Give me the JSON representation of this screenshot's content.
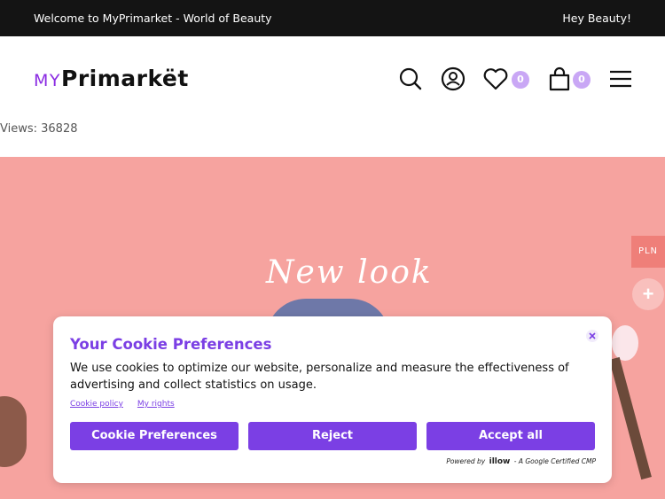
{
  "topbar": {
    "welcome": "Welcome to MyPrimarket - World of Beauty",
    "greeting": "Hey Beauty!"
  },
  "header": {
    "logo_my": "MY",
    "logo_brand": "Primarkët",
    "wishlist_count": "0",
    "cart_count": "0",
    "icons": [
      "search-icon",
      "user-icon",
      "heart-icon",
      "shopping-bag-icon",
      "menu-icon"
    ]
  },
  "views": "Views: 36828",
  "hero": {
    "title": "New look"
  },
  "side": {
    "currency": "PLN",
    "plus": "+"
  },
  "cookie": {
    "title": "Your Cookie Preferences",
    "text": "We use cookies to optimize our website, personalize and measure the effectiveness of advertising and collect statistics on usage.",
    "link_policy": "Cookie policy",
    "link_rights": "My rights",
    "btn_preferences": "Cookie Preferences",
    "btn_reject": "Reject",
    "btn_accept": "Accept all",
    "powered_by": "Powered by",
    "powered_brand": "illow",
    "powered_note": "- A Google Certified CMP"
  },
  "colors": {
    "accent": "#7b3fe4",
    "hero_bg": "#f6a39f",
    "badge": "#c9a7f5",
    "topbar": "#141414"
  }
}
